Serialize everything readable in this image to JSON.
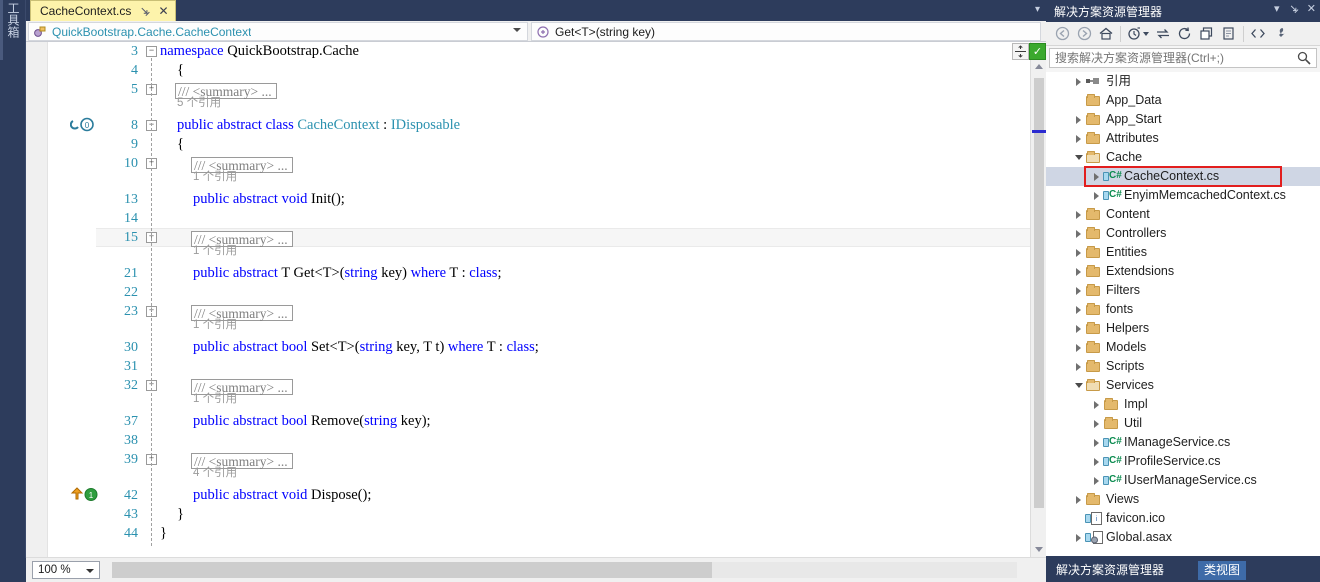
{
  "toolbox": {
    "label": "工具箱"
  },
  "editor": {
    "tab": {
      "title": "CacheContext.cs",
      "pin_icon": "pin-icon",
      "close_icon": "close-icon"
    },
    "navbar": {
      "type_dropdown": "QuickBootstrap.Cache.CacheContext",
      "member_dropdown": "Get<T>(string key)"
    },
    "zoom_level": "100 %",
    "lines": [
      {
        "num": "3",
        "outline": "minus",
        "indent": 0,
        "segments": [
          {
            "t": "namespace ",
            "c": "kw"
          },
          {
            "t": "QuickBootstrap.Cache",
            "c": "plain"
          }
        ]
      },
      {
        "num": "4",
        "outline": "",
        "indent": 1,
        "segments": [
          {
            "t": "{",
            "c": "plain"
          }
        ]
      },
      {
        "num": "5",
        "outline": "plus",
        "indent": 1,
        "collapsed_comment": "/// <summary> ...",
        "codelens": "5 个引用"
      },
      {
        "num": "8",
        "outline": "minus",
        "indent": 1,
        "glyph": "references-icon",
        "segments": [
          {
            "t": "public abstract class ",
            "c": "kw"
          },
          {
            "t": "CacheContext",
            "c": "type"
          },
          {
            "t": " : ",
            "c": "plain"
          },
          {
            "t": "IDisposable",
            "c": "type"
          }
        ]
      },
      {
        "num": "9",
        "outline": "",
        "indent": 1,
        "segments": [
          {
            "t": "{",
            "c": "plain"
          }
        ]
      },
      {
        "num": "10",
        "outline": "plus",
        "indent": 2,
        "collapsed_comment": "/// <summary> ...",
        "codelens": "1 个引用"
      },
      {
        "num": "13",
        "outline": "",
        "indent": 2,
        "segments": [
          {
            "t": "public abstract void ",
            "c": "kw"
          },
          {
            "t": "Init();",
            "c": "plain"
          }
        ]
      },
      {
        "num": "14",
        "outline": "",
        "indent": 2,
        "segments": []
      },
      {
        "num": "15",
        "outline": "plus",
        "indent": 2,
        "collapsed_comment": "/// <summary> ...",
        "codelens": "1 个引用",
        "highlighted": true
      },
      {
        "num": "21",
        "outline": "",
        "indent": 2,
        "segments": [
          {
            "t": "public abstract ",
            "c": "kw"
          },
          {
            "t": "T Get<T>(",
            "c": "plain"
          },
          {
            "t": "string",
            "c": "kw"
          },
          {
            "t": " key) ",
            "c": "plain"
          },
          {
            "t": "where",
            "c": "kw"
          },
          {
            "t": " T : ",
            "c": "plain"
          },
          {
            "t": "class",
            "c": "kw"
          },
          {
            "t": ";",
            "c": "plain"
          }
        ]
      },
      {
        "num": "22",
        "outline": "",
        "indent": 2,
        "segments": []
      },
      {
        "num": "23",
        "outline": "plus",
        "indent": 2,
        "collapsed_comment": "/// <summary> ...",
        "codelens": "1 个引用"
      },
      {
        "num": "30",
        "outline": "",
        "indent": 2,
        "segments": [
          {
            "t": "public abstract bool ",
            "c": "kw"
          },
          {
            "t": "Set<T>(",
            "c": "plain"
          },
          {
            "t": "string",
            "c": "kw"
          },
          {
            "t": " key, T t) ",
            "c": "plain"
          },
          {
            "t": "where",
            "c": "kw"
          },
          {
            "t": " T : ",
            "c": "plain"
          },
          {
            "t": "class",
            "c": "kw"
          },
          {
            "t": ";",
            "c": "plain"
          }
        ]
      },
      {
        "num": "31",
        "outline": "",
        "indent": 2,
        "segments": []
      },
      {
        "num": "32",
        "outline": "plus",
        "indent": 2,
        "collapsed_comment": "/// <summary> ...",
        "codelens": "1 个引用"
      },
      {
        "num": "37",
        "outline": "",
        "indent": 2,
        "segments": [
          {
            "t": "public abstract bool ",
            "c": "kw"
          },
          {
            "t": "Remove(",
            "c": "plain"
          },
          {
            "t": "string",
            "c": "kw"
          },
          {
            "t": " key);",
            "c": "plain"
          }
        ]
      },
      {
        "num": "38",
        "outline": "",
        "indent": 2,
        "segments": []
      },
      {
        "num": "39",
        "outline": "plus",
        "indent": 2,
        "collapsed_comment": "/// <summary> ...",
        "codelens": "4 个引用"
      },
      {
        "num": "42",
        "outline": "",
        "indent": 2,
        "glyph": "override-icon",
        "segments": [
          {
            "t": "public abstract void ",
            "c": "kw"
          },
          {
            "t": "Dispose();",
            "c": "plain"
          }
        ]
      },
      {
        "num": "43",
        "outline": "",
        "indent": 1,
        "segments": [
          {
            "t": "}",
            "c": "plain"
          }
        ]
      },
      {
        "num": "44",
        "outline": "",
        "indent": 0,
        "segments": [
          {
            "t": "}",
            "c": "plain"
          }
        ]
      }
    ],
    "split_button_icon": "split-view-icon",
    "health_button_icon": "code-health-check-icon"
  },
  "solution_explorer": {
    "title": "解决方案资源管理器",
    "header_icons": [
      "chevron-down-icon",
      "pin-icon",
      "close-icon"
    ],
    "toolbar": [
      {
        "name": "back-icon",
        "glyph": "←"
      },
      {
        "name": "forward-icon",
        "glyph": "→"
      },
      {
        "name": "home-icon",
        "glyph": "⌂"
      },
      {
        "name": "pending-changes-icon",
        "glyph": "◔"
      },
      {
        "name": "sync-with-active-document-icon",
        "glyph": "⇄"
      },
      {
        "name": "refresh-icon",
        "glyph": "⟳"
      },
      {
        "name": "collapse-all-icon",
        "glyph": "▣"
      },
      {
        "name": "show-all-files-icon",
        "glyph": "▤"
      },
      {
        "name": "view-code-icon",
        "glyph": "<>"
      },
      {
        "name": "properties-icon",
        "glyph": "🔧"
      }
    ],
    "search": {
      "placeholder": "搜索解决方案资源管理器(Ctrl+;)",
      "value": "",
      "icon": "search-icon"
    },
    "tree": [
      {
        "label": "引用",
        "indent": 1,
        "twist": "right",
        "icon": "references-icon"
      },
      {
        "label": "App_Data",
        "indent": 1,
        "twist": "none",
        "icon": "folder-icon"
      },
      {
        "label": "App_Start",
        "indent": 1,
        "twist": "right",
        "icon": "folder-icon"
      },
      {
        "label": "Attributes",
        "indent": 1,
        "twist": "right",
        "icon": "folder-icon"
      },
      {
        "label": "Cache",
        "indent": 1,
        "twist": "down",
        "icon": "folder-open-icon"
      },
      {
        "label": "CacheContext.cs",
        "indent": 2,
        "twist": "right",
        "icon": "csharp-file-icon",
        "selected": true,
        "highlight_box": true
      },
      {
        "label": "EnyimMemcachedContext.cs",
        "indent": 2,
        "twist": "right",
        "icon": "csharp-file-icon"
      },
      {
        "label": "Content",
        "indent": 1,
        "twist": "right",
        "icon": "folder-icon"
      },
      {
        "label": "Controllers",
        "indent": 1,
        "twist": "right",
        "icon": "folder-icon"
      },
      {
        "label": "Entities",
        "indent": 1,
        "twist": "right",
        "icon": "folder-icon"
      },
      {
        "label": "Extendsions",
        "indent": 1,
        "twist": "right",
        "icon": "folder-icon"
      },
      {
        "label": "Filters",
        "indent": 1,
        "twist": "right",
        "icon": "folder-icon"
      },
      {
        "label": "fonts",
        "indent": 1,
        "twist": "right",
        "icon": "folder-icon"
      },
      {
        "label": "Helpers",
        "indent": 1,
        "twist": "right",
        "icon": "folder-icon"
      },
      {
        "label": "Models",
        "indent": 1,
        "twist": "right",
        "icon": "folder-icon"
      },
      {
        "label": "Scripts",
        "indent": 1,
        "twist": "right",
        "icon": "folder-icon"
      },
      {
        "label": "Services",
        "indent": 1,
        "twist": "down",
        "icon": "folder-open-icon"
      },
      {
        "label": "Impl",
        "indent": 2,
        "twist": "right",
        "icon": "folder-icon"
      },
      {
        "label": "Util",
        "indent": 2,
        "twist": "right",
        "icon": "folder-icon"
      },
      {
        "label": "IManageService.cs",
        "indent": 2,
        "twist": "right",
        "icon": "csharp-file-icon"
      },
      {
        "label": "IProfileService.cs",
        "indent": 2,
        "twist": "right",
        "icon": "csharp-file-icon"
      },
      {
        "label": "IUserManageService.cs",
        "indent": 2,
        "twist": "right",
        "icon": "csharp-file-icon"
      },
      {
        "label": "Views",
        "indent": 1,
        "twist": "right",
        "icon": "folder-icon"
      },
      {
        "label": "favicon.ico",
        "indent": 1,
        "twist": "none",
        "icon": "ico-file-icon"
      },
      {
        "label": "Global.asax",
        "indent": 1,
        "twist": "right",
        "icon": "asax-file-icon"
      }
    ],
    "footer_tabs": [
      {
        "label": "解决方案资源管理器",
        "active": false
      },
      {
        "label": "类视图",
        "active": true
      }
    ]
  },
  "colors": {
    "chrome": "#2d3c5c",
    "tab_active": "#fdf3ab",
    "keyword": "#0000ff",
    "type": "#2b91af",
    "comment": "#808080",
    "linenumber": "#2b91af",
    "selection": "#cfd6e4",
    "highlight_box": "#e21e1e",
    "health_ok": "#3ba92e"
  }
}
